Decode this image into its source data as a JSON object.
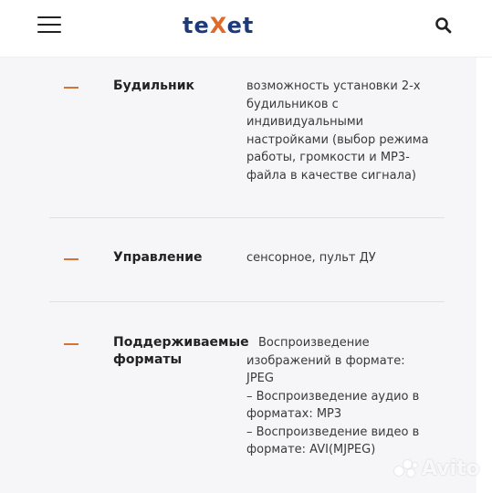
{
  "header": {
    "logo_prefix": "te",
    "logo_x": "X",
    "logo_suffix": "et",
    "menu_icon": "hamburger-menu-icon",
    "search_icon": "search-icon"
  },
  "specs": [
    {
      "label": "Будильник",
      "value_lines": [
        "возможность установки 2-х",
        "будильников с",
        "индивидуальными",
        "настройками (выбор режима",
        "работы, громкости и MP3-",
        "файла в качестве сигнала)"
      ]
    },
    {
      "label": "Управление",
      "value_lines": [
        "сенсорное, пульт ДУ"
      ]
    },
    {
      "label_lines": [
        "Поддерживаемые",
        "форматы"
      ],
      "value_lines": [
        "Воспроизведение",
        "изображений в формате:",
        "JPEG",
        "– Воспроизведение аудио в",
        "форматах: MP3",
        "– Воспроизведение видео в",
        "формате: AVI(MJPEG)"
      ]
    }
  ],
  "watermark": "Avito",
  "colors": {
    "accent": "#d2743a",
    "logo_blue": "#1d3a7a",
    "logo_orange": "#e06a2a",
    "panel_bg": "#f6f5f7"
  }
}
